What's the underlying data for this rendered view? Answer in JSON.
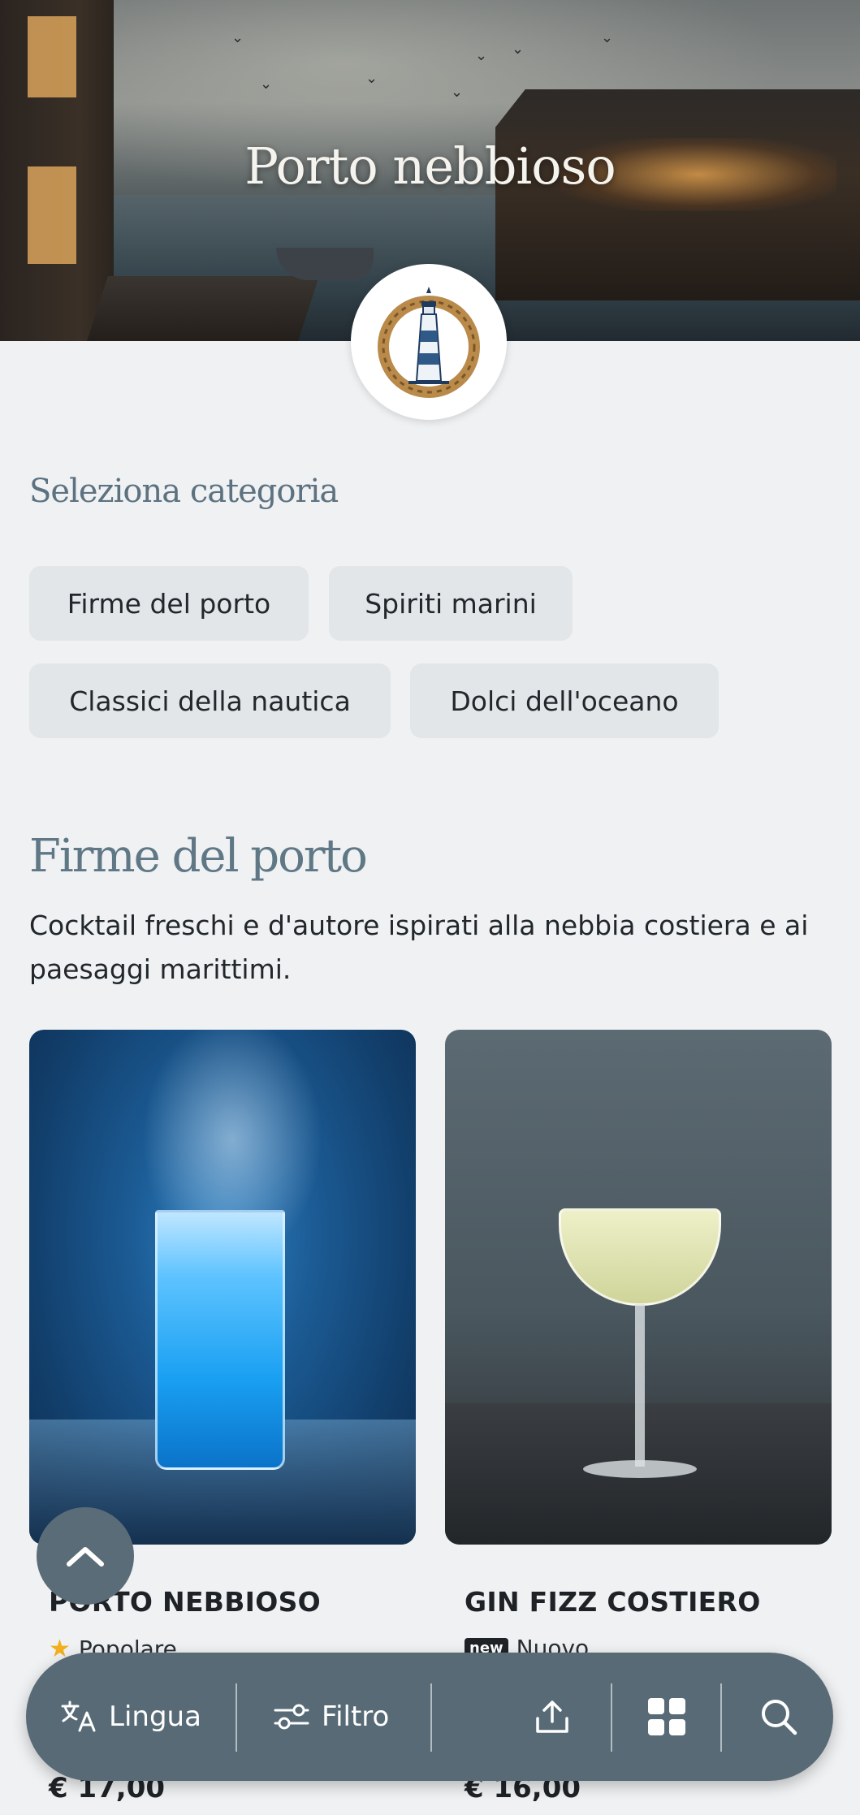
{
  "hero": {
    "title": "Porto nebbioso",
    "logo_icon": "lighthouse-rope-icon"
  },
  "categories": {
    "heading": "Seleziona categoria",
    "items": [
      "Firme del porto",
      "Spiriti marini",
      "Classici della nautica",
      "Dolci dell'oceano"
    ]
  },
  "section": {
    "title": "Firme del porto",
    "description": "Cocktail freschi e d'autore ispirati alla nebbia costiera e ai paesaggi marittimi."
  },
  "products": [
    {
      "name": "PORTO NEBBIOSO",
      "tag_icon": "star-icon",
      "tag": "Popolare",
      "price": "€ 17,00"
    },
    {
      "name": "GIN FIZZ COSTIERO",
      "tag_badge": "new",
      "tag": "Nuovo",
      "price": "€ 16,00"
    }
  ],
  "bottom_bar": {
    "language_label": "Lingua",
    "filter_label": "Filtro",
    "share_icon": "share-icon",
    "grid_icon": "grid-view-icon",
    "search_icon": "search-icon"
  },
  "scroll_top_icon": "chevron-up-icon",
  "colors": {
    "accent": "#576a76",
    "heading": "#607886",
    "background": "#eff1f3",
    "chip": "#e3e6e9"
  }
}
